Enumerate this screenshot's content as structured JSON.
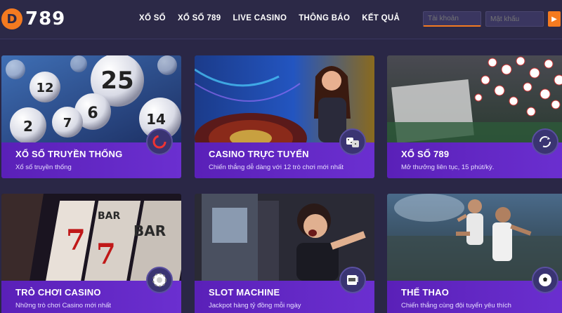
{
  "brand": {
    "logo_mark": "D",
    "logo_text": "789",
    "accent": "#f47a20"
  },
  "nav": [
    "XỔ SỐ",
    "XỔ SỐ 789",
    "LIVE CASINO",
    "THÔNG BÁO",
    "KẾT QUẢ"
  ],
  "login": {
    "username_placeholder": "Tài khoản",
    "password_placeholder": "Mật khẩu",
    "submit_icon": "arrow-right-icon"
  },
  "cards": [
    {
      "title": "XỔ SỐ TRUYỀN THỐNG",
      "desc": "Xổ số truyền thống",
      "icon": "spinner-icon"
    },
    {
      "title": "CASINO TRỰC TUYẾN",
      "desc": "Chiến thắng dễ dàng với 12 trò chơi mới nhất",
      "icon": "dice-icon"
    },
    {
      "title": "XỔ SỐ 789",
      "desc": "Mở thưởng liên tục, 15 phút/kỳ.",
      "icon": "refresh-icon"
    },
    {
      "title": "TRÒ CHƠI CASINO",
      "desc": "Những trò chơi Casino mới nhất",
      "icon": "chip-icon"
    },
    {
      "title": "SLOT MACHINE",
      "desc": "Jackpot hàng tỷ đồng mỗi ngày",
      "icon": "slot-machine-icon"
    },
    {
      "title": "THỂ THAO",
      "desc": "Chiến thắng cùng đội tuyển yêu thích",
      "icon": "soccer-ball-icon"
    }
  ],
  "lottery_balls": [
    "25",
    "12",
    "6",
    "7",
    "2",
    "14"
  ],
  "slot_reel_labels": [
    "7",
    "BAR",
    "7",
    "BAR"
  ]
}
